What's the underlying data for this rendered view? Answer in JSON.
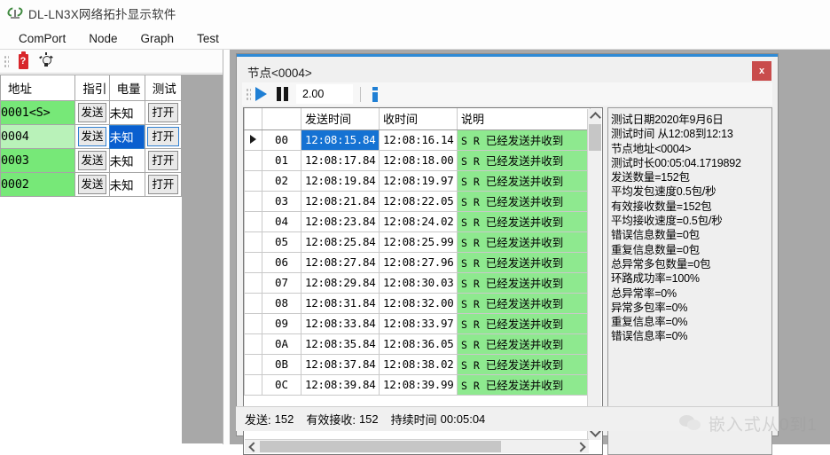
{
  "window": {
    "title": "DL-LN3X网络拓扑显示软件",
    "icon": "antenna-icon"
  },
  "menubar": {
    "items": [
      {
        "label": "ComPort"
      },
      {
        "label": "Node"
      },
      {
        "label": "Graph"
      },
      {
        "label": "Test"
      }
    ]
  },
  "toolbar": {
    "buttons": [
      {
        "icon": "battery-icon",
        "label": "?"
      },
      {
        "icon": "lightbulb-icon",
        "label": ""
      }
    ]
  },
  "node_table": {
    "headers": [
      "地址",
      "指引",
      "电量",
      "测试"
    ],
    "rows": [
      {
        "address": "0001<S>",
        "send": "发送",
        "power": "未知",
        "test": "打开",
        "selected": false
      },
      {
        "address": "0004",
        "send": "发送",
        "power": "未知",
        "test": "打开",
        "selected": true
      },
      {
        "address": "0003",
        "send": "发送",
        "power": "未知",
        "test": "打开",
        "selected": false
      },
      {
        "address": "0002",
        "send": "发送",
        "power": "未知",
        "test": "打开",
        "selected": false
      }
    ]
  },
  "dialog": {
    "title": "节点<0004>",
    "close_label": "x",
    "toolbar": {
      "play_icon": "play-icon",
      "pause_icon": "pause-icon",
      "speed_value": "2.00",
      "info_icon": "info-icon"
    },
    "log_table": {
      "headers": [
        "",
        "",
        "发送时间",
        "收时间",
        "说明"
      ],
      "rows": [
        {
          "marker": "▶",
          "index": "00",
          "send_time": "12:08:15.84",
          "recv_time": "12:08:16.14",
          "sr": "S R",
          "desc": "已经发送并收到",
          "selected": true
        },
        {
          "marker": "",
          "index": "01",
          "send_time": "12:08:17.84",
          "recv_time": "12:08:18.00",
          "sr": "S R",
          "desc": "已经发送并收到",
          "selected": false
        },
        {
          "marker": "",
          "index": "02",
          "send_time": "12:08:19.84",
          "recv_time": "12:08:19.97",
          "sr": "S R",
          "desc": "已经发送并收到",
          "selected": false
        },
        {
          "marker": "",
          "index": "03",
          "send_time": "12:08:21.84",
          "recv_time": "12:08:22.05",
          "sr": "S R",
          "desc": "已经发送并收到",
          "selected": false
        },
        {
          "marker": "",
          "index": "04",
          "send_time": "12:08:23.84",
          "recv_time": "12:08:24.02",
          "sr": "S R",
          "desc": "已经发送并收到",
          "selected": false
        },
        {
          "marker": "",
          "index": "05",
          "send_time": "12:08:25.84",
          "recv_time": "12:08:25.99",
          "sr": "S R",
          "desc": "已经发送并收到",
          "selected": false
        },
        {
          "marker": "",
          "index": "06",
          "send_time": "12:08:27.84",
          "recv_time": "12:08:27.96",
          "sr": "S R",
          "desc": "已经发送并收到",
          "selected": false
        },
        {
          "marker": "",
          "index": "07",
          "send_time": "12:08:29.84",
          "recv_time": "12:08:30.03",
          "sr": "S R",
          "desc": "已经发送并收到",
          "selected": false
        },
        {
          "marker": "",
          "index": "08",
          "send_time": "12:08:31.84",
          "recv_time": "12:08:32.00",
          "sr": "S R",
          "desc": "已经发送并收到",
          "selected": false
        },
        {
          "marker": "",
          "index": "09",
          "send_time": "12:08:33.84",
          "recv_time": "12:08:33.97",
          "sr": "S R",
          "desc": "已经发送并收到",
          "selected": false
        },
        {
          "marker": "",
          "index": "0A",
          "send_time": "12:08:35.84",
          "recv_time": "12:08:36.05",
          "sr": "S R",
          "desc": "已经发送并收到",
          "selected": false
        },
        {
          "marker": "",
          "index": "0B",
          "send_time": "12:08:37.84",
          "recv_time": "12:08:38.02",
          "sr": "S R",
          "desc": "已经发送并收到",
          "selected": false
        },
        {
          "marker": "",
          "index": "0C",
          "send_time": "12:08:39.84",
          "recv_time": "12:08:39.99",
          "sr": "S R",
          "desc": "已经发送并收到",
          "selected": false
        }
      ]
    },
    "stats": [
      "测试日期2020年9月6日",
      "测试时间 从12:08到12:13",
      "节点地址<0004>",
      "测试时长00:05:04.1719892",
      "发送数量=152包",
      "平均发包速度0.5包/秒",
      "有效接收数量=152包",
      "平均接收速度=0.5包/秒",
      "错误信息数量=0包",
      "重复信息数量=0包",
      "总异常多包数量=0包",
      "环路成功率=100%",
      "总异常率=0%",
      "异常多包率=0%",
      "重复信息率=0%",
      "错误信息率=0%"
    ],
    "statusbar": {
      "send_label": "发送:",
      "send_value": "152",
      "recv_label": "有效接收:",
      "recv_value": "152",
      "duration_label": "持续时间",
      "duration_value": "00:05:04"
    }
  },
  "watermark": {
    "text": "嵌入式从0到1",
    "icon": "wechat-icon"
  },
  "colors": {
    "accent": "#2e8ad6",
    "node_green": "#77e878",
    "node_green_selected": "#b9f2b9",
    "row_green": "#8ee98f",
    "selection_blue": "#1572d3",
    "close_red": "#c94c4c"
  }
}
